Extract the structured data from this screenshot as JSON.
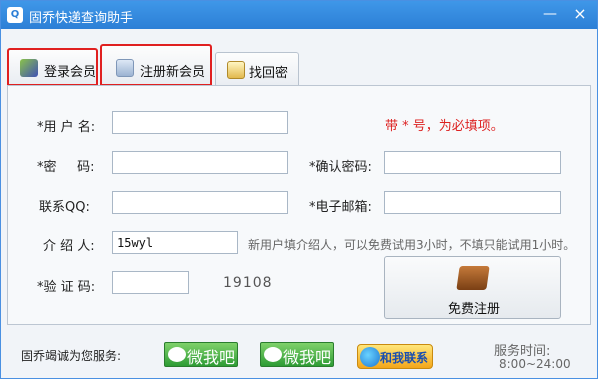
{
  "window": {
    "title": "固乔快递查询助手",
    "minimize_glyph": "—",
    "close_glyph": "×"
  },
  "tabs": [
    {
      "label": "登录会员",
      "icon": "member-login-icon",
      "highlighted": true
    },
    {
      "label": "注册新会员",
      "icon": "register-form-icon",
      "highlighted": true
    },
    {
      "label": "找回密码",
      "icon": "password-note-icon",
      "highlighted": false
    }
  ],
  "form": {
    "username_label": "*用 户 名:",
    "username_value": "",
    "required_note": "带 * 号，为必填项。",
    "password_label": "*密     码:",
    "password_value": "",
    "confirm_label": "*确认密码:",
    "confirm_value": "",
    "qq_label": "联系QQ:",
    "qq_value": "",
    "email_label": "*电子邮箱:",
    "email_value": "",
    "referrer_label": "介 绍 人:",
    "referrer_value": "15wyl",
    "referrer_hint": "新用户填介绍人，可以免费试用3小时，不填只能试用1小时。",
    "captcha_label": "*验 证 码:",
    "captcha_value": "",
    "captcha_code": "19108",
    "register_button": "免费注册"
  },
  "footer": {
    "service_text": "固乔竭诚为您服务:",
    "wechat1": "微我吧",
    "wechat2": "微我吧",
    "contact": "和我联系",
    "service_hours_title": "服务时间:",
    "service_hours": "8:00~24:00"
  },
  "colors": {
    "accent": "#2c7fd6",
    "required_red": "#d22222",
    "highlight_border": "#e02020"
  }
}
